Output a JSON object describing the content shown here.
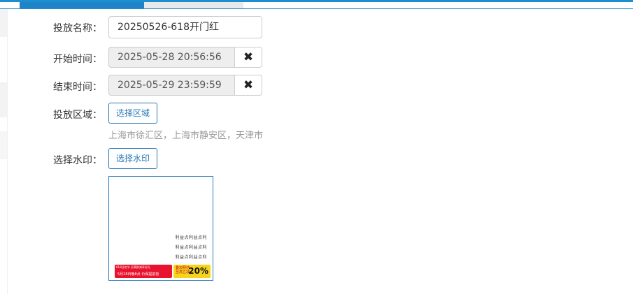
{
  "form": {
    "name_label": "投放名称：",
    "name_value": "20250526-618开门红",
    "start_label": "开始时间：",
    "start_value": "2025-05-28 20:56:56",
    "end_label": "结束时间：",
    "end_value": "2025-05-29 23:59:59",
    "region_label": "投放区域：",
    "region_button": "选择区域",
    "region_selected": "上海市徐汇区，上海市静安区，天津市",
    "watermark_label": "选择水印：",
    "watermark_button": "选择水印",
    "clear_glyph": "✖"
  },
  "watermark_preview": {
    "text_lines": [
      "利益点利益点利",
      "利益点利益点利",
      "利益点利益点利"
    ],
    "banner_line1": "618狂欢节  买满即减享好礼",
    "banner_line2": "5月28日晚8点  价保提前抢",
    "badge_small_top": "叠加预估",
    "badge_small_bottom": "至高立减",
    "badge_big": "20%",
    "colors": {
      "banner_red": "#e8132f",
      "badge_yellow": "#f7d41c"
    }
  },
  "colors": {
    "accent": "#2a7ab8",
    "tab_bar": "#1f83c7"
  }
}
